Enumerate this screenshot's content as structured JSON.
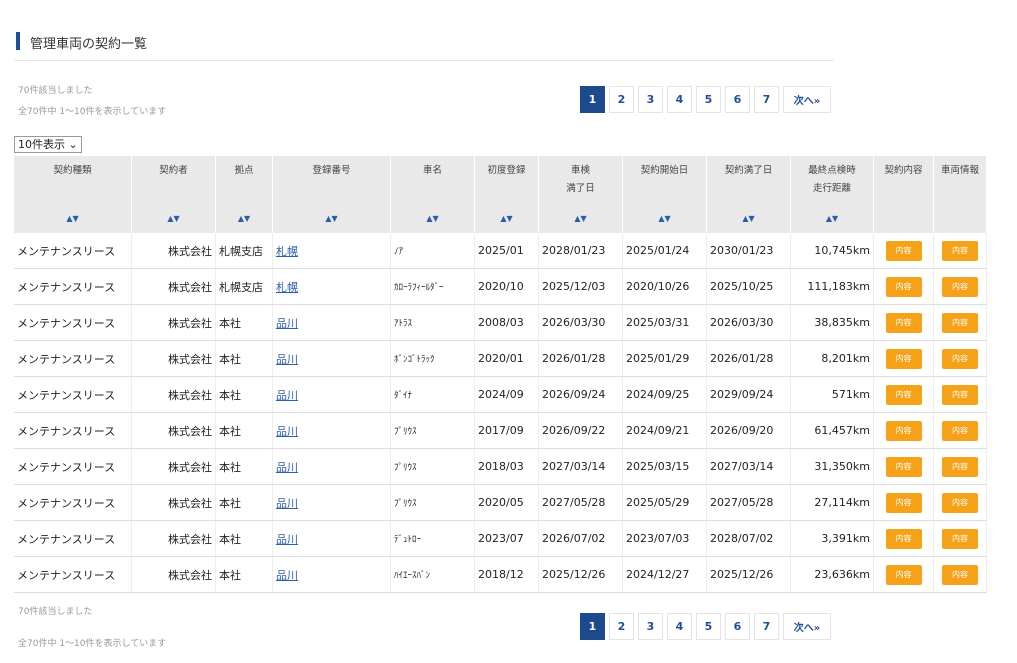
{
  "page_title": "管理車両の契約一覧",
  "top_info": {
    "count_text": "70件該当しました",
    "range_text": "全70件中 1～10件を表示しています"
  },
  "bottom_info": {
    "count_text": "70件該当しました",
    "range_text": "全70件中 1～10件を表示しています"
  },
  "pager": {
    "pages": [
      "1",
      "2",
      "3",
      "4",
      "5",
      "6",
      "7"
    ],
    "active": "1",
    "next_label": "次へ»"
  },
  "per_page": "10件表示 ⌄",
  "sort_glyph": "▲▼",
  "columns": [
    "契約種類",
    "契約者",
    "拠点",
    "登録番号",
    "車名",
    "初度登録",
    "車検\n満了日",
    "契約開始日",
    "契約満了日",
    "最終点検時\n走行距離",
    "契約内容",
    "車両情報"
  ],
  "button_label": "内容",
  "rows": [
    {
      "type": "メンテナンスリース",
      "holder": "株式会社",
      "base": "札幌支店",
      "reg": "札幌",
      "car": "ﾉｱ",
      "first": "2025/01",
      "shaken": "2028/01/23",
      "start": "2025/01/24",
      "end": "2030/01/23",
      "mileage": "10,745km"
    },
    {
      "type": "メンテナンスリース",
      "holder": "株式会社",
      "base": "札幌支店",
      "reg": "札幌",
      "car": "ｶﾛｰﾗﾌｨｰﾙﾀﾞｰ",
      "first": "2020/10",
      "shaken": "2025/12/03",
      "start": "2020/10/26",
      "end": "2025/10/25",
      "mileage": "111,183km"
    },
    {
      "type": "メンテナンスリース",
      "holder": "株式会社",
      "base": "本社",
      "reg": "品川",
      "car": "ｱﾄﾗｽ",
      "first": "2008/03",
      "shaken": "2026/03/30",
      "start": "2025/03/31",
      "end": "2026/03/30",
      "mileage": "38,835km"
    },
    {
      "type": "メンテナンスリース",
      "holder": "株式会社",
      "base": "本社",
      "reg": "品川",
      "car": "ﾎﾞﾝｺﾞﾄﾗｯｸ",
      "first": "2020/01",
      "shaken": "2026/01/28",
      "start": "2025/01/29",
      "end": "2026/01/28",
      "mileage": "8,201km"
    },
    {
      "type": "メンテナンスリース",
      "holder": "株式会社",
      "base": "本社",
      "reg": "品川",
      "car": "ﾀﾞｲﾅ",
      "first": "2024/09",
      "shaken": "2026/09/24",
      "start": "2024/09/25",
      "end": "2029/09/24",
      "mileage": "571km"
    },
    {
      "type": "メンテナンスリース",
      "holder": "株式会社",
      "base": "本社",
      "reg": "品川",
      "car": "ﾌﾟﾘｳｽ",
      "first": "2017/09",
      "shaken": "2026/09/22",
      "start": "2024/09/21",
      "end": "2026/09/20",
      "mileage": "61,457km"
    },
    {
      "type": "メンテナンスリース",
      "holder": "株式会社",
      "base": "本社",
      "reg": "品川",
      "car": "ﾌﾟﾘｳｽ",
      "first": "2018/03",
      "shaken": "2027/03/14",
      "start": "2025/03/15",
      "end": "2027/03/14",
      "mileage": "31,350km"
    },
    {
      "type": "メンテナンスリース",
      "holder": "株式会社",
      "base": "本社",
      "reg": "品川",
      "car": "ﾌﾟﾘｳｽ",
      "first": "2020/05",
      "shaken": "2027/05/28",
      "start": "2025/05/29",
      "end": "2027/05/28",
      "mileage": "27,114km"
    },
    {
      "type": "メンテナンスリース",
      "holder": "株式会社",
      "base": "本社",
      "reg": "品川",
      "car": "ﾃﾞｭﾄﾛｰ",
      "first": "2023/07",
      "shaken": "2026/07/02",
      "start": "2023/07/03",
      "end": "2028/07/02",
      "mileage": "3,391km"
    },
    {
      "type": "メンテナンスリース",
      "holder": "株式会社",
      "base": "本社",
      "reg": "品川",
      "car": "ﾊｲｴｰｽﾊﾞﾝ",
      "first": "2018/12",
      "shaken": "2025/12/26",
      "start": "2024/12/27",
      "end": "2025/12/26",
      "mileage": "23,636km"
    }
  ],
  "colors": {
    "accent": "#1f4f9c",
    "button": "#f5a219",
    "header_bg": "#e9e9e9"
  }
}
